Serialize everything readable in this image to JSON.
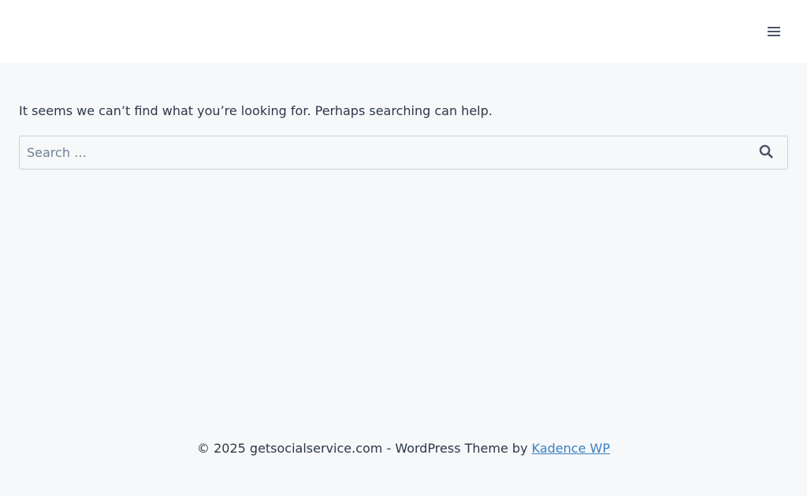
{
  "header": {
    "menu_icon": "hamburger-menu-icon"
  },
  "main": {
    "message": "It seems we can’t find what you’re looking for. Perhaps searching can help.",
    "search": {
      "placeholder": "Search …",
      "value": "",
      "submit_icon": "search-icon"
    }
  },
  "footer": {
    "copyright": "© 2025 getsocialservice.com - WordPress Theme by",
    "link_label": "Kadence WP"
  },
  "colors": {
    "page_background": "#f6f8fa",
    "header_background": "#ffffff",
    "text": "#2d3748",
    "link": "#3a7fc1",
    "icon": "#4a5568"
  }
}
